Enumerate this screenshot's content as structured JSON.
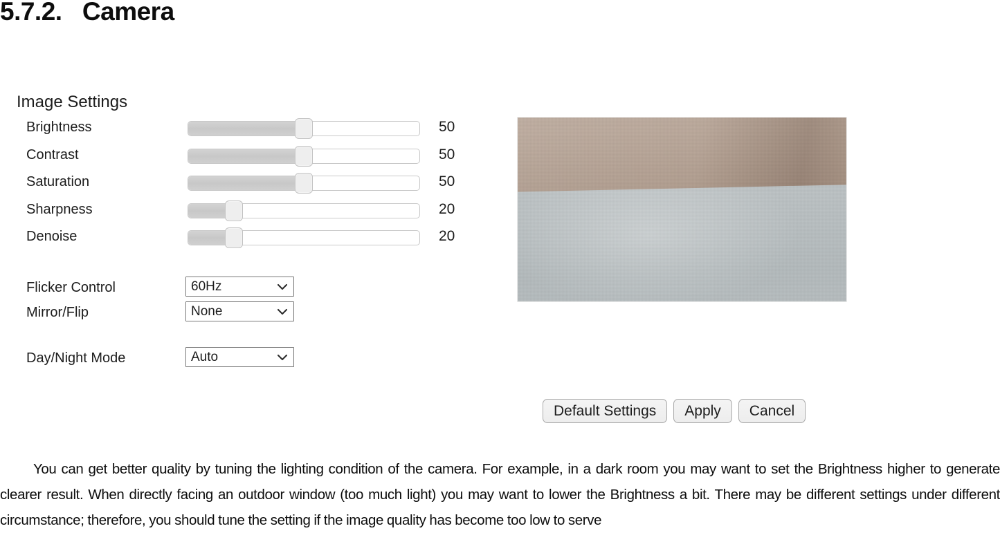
{
  "heading": "5.7.2.   Camera",
  "panel": {
    "title": "Image Settings",
    "sliders": [
      {
        "label": "Brightness",
        "value": "50",
        "percent": 50
      },
      {
        "label": "Contrast",
        "value": "50",
        "percent": 50
      },
      {
        "label": "Saturation",
        "value": "50",
        "percent": 50
      },
      {
        "label": "Sharpness",
        "value": "20",
        "percent": 20
      },
      {
        "label": "Denoise",
        "value": "20",
        "percent": 20
      }
    ],
    "selects": [
      {
        "label": "Flicker Control",
        "value": "60Hz"
      },
      {
        "label": "Mirror/Flip",
        "value": "None"
      },
      {
        "label": "Day/Night Mode",
        "value": "Auto"
      }
    ]
  },
  "preview": {
    "alt": "camera-live-view",
    "upper_color": "#b7a496",
    "lower_color": "#b4babc"
  },
  "buttons": [
    {
      "label": "Default Settings"
    },
    {
      "label": "Apply"
    },
    {
      "label": "Cancel"
    }
  ],
  "paragraph": "You can get better quality by tuning the lighting condition of the camera. For example, in a dark room you may want to set the Brightness higher to generate clearer result. When directly facing an outdoor window (too much light) you may want to lower the Brightness a bit. There may be different settings under different circumstance; therefore, you should tune the setting if the image quality has become too low to serve"
}
